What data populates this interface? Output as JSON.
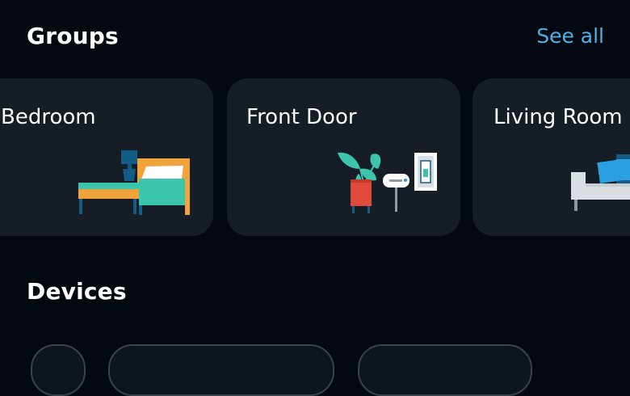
{
  "groups": {
    "title": "Groups",
    "see_all_label": "See all",
    "cards": [
      {
        "label": "Bedroom",
        "icon": "bedroom-illustration"
      },
      {
        "label": "Front Door",
        "icon": "front-door-illustration"
      },
      {
        "label": "Living Room",
        "icon": "living-room-illustration"
      }
    ]
  },
  "devices": {
    "title": "Devices"
  },
  "colors": {
    "background": "#040910",
    "card": "#161d25",
    "accent_link": "#4ab3ea",
    "text": "#ffffff"
  }
}
